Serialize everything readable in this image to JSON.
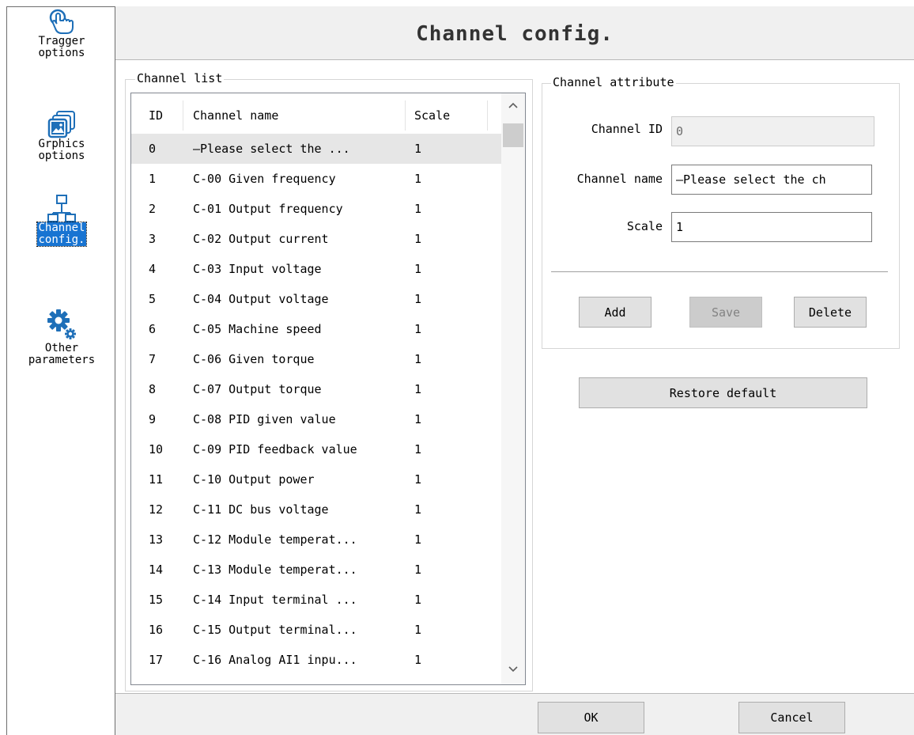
{
  "nav": {
    "items": [
      {
        "label": "Tragger\noptions",
        "icon": "touch-hand-icon"
      },
      {
        "label": "Grphics\noptions",
        "icon": "pictures-icon"
      },
      {
        "label": "Channel\nconfig.",
        "icon": "network-icon",
        "selected": true
      },
      {
        "label": "Other\nparameters",
        "icon": "gears-icon"
      }
    ]
  },
  "title": "Channel config.",
  "channel_list": {
    "legend": "Channel list",
    "columns": [
      "ID",
      "Channel name",
      "Scale"
    ],
    "rows": [
      {
        "id": "0",
        "name": "—Please select the ...",
        "scale": "1"
      },
      {
        "id": "1",
        "name": "C-00 Given frequency",
        "scale": "1"
      },
      {
        "id": "2",
        "name": "C-01 Output frequency",
        "scale": "1"
      },
      {
        "id": "3",
        "name": "C-02 Output current",
        "scale": "1"
      },
      {
        "id": "4",
        "name": "C-03 Input voltage",
        "scale": "1"
      },
      {
        "id": "5",
        "name": "C-04 Output voltage",
        "scale": "1"
      },
      {
        "id": "6",
        "name": "C-05 Machine speed",
        "scale": "1"
      },
      {
        "id": "7",
        "name": "C-06 Given torque",
        "scale": "1"
      },
      {
        "id": "8",
        "name": "C-07 Output torque",
        "scale": "1"
      },
      {
        "id": "9",
        "name": "C-08 PID given value",
        "scale": "1"
      },
      {
        "id": "10",
        "name": "C-09 PID feedback value",
        "scale": "1"
      },
      {
        "id": "11",
        "name": "C-10 Output power",
        "scale": "1"
      },
      {
        "id": "12",
        "name": "C-11 DC bus voltage",
        "scale": "1"
      },
      {
        "id": "13",
        "name": "C-12 Module temperat...",
        "scale": "1"
      },
      {
        "id": "14",
        "name": "C-13 Module temperat...",
        "scale": "1"
      },
      {
        "id": "15",
        "name": "C-14 Input terminal ...",
        "scale": "1"
      },
      {
        "id": "16",
        "name": "C-15 Output terminal...",
        "scale": "1"
      },
      {
        "id": "17",
        "name": "C-16 Analog AI1 inpu...",
        "scale": "1"
      }
    ],
    "selected_row": 0
  },
  "attribute": {
    "legend": "Channel attribute",
    "channel_id_label": "Channel ID",
    "channel_id_value": "0",
    "channel_name_label": "Channel name",
    "channel_name_value": "—Please select the ch",
    "scale_label": "Scale",
    "scale_value": "1",
    "add_label": "Add",
    "save_label": "Save",
    "delete_label": "Delete",
    "restore_label": "Restore default"
  },
  "footer": {
    "ok_label": "OK",
    "cancel_label": "Cancel"
  },
  "colors": {
    "selection": "#1874d2",
    "row_selected": "#e6e6e6",
    "toolbar_bg": "#f0f0f0"
  }
}
